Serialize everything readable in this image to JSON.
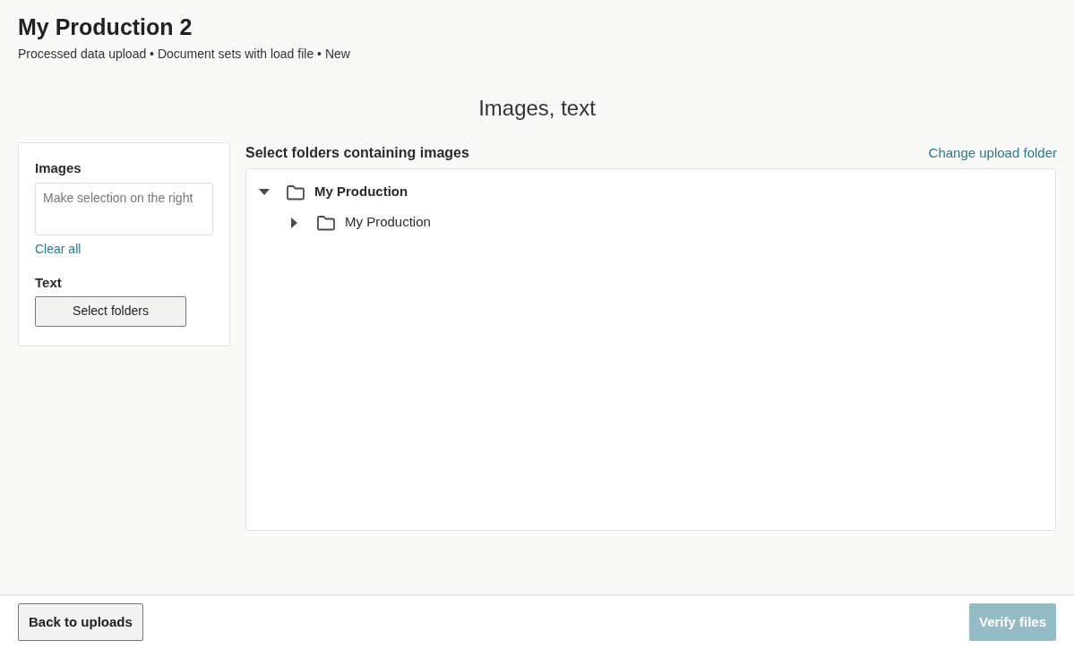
{
  "header": {
    "title": "My Production 2",
    "subtitle": "Processed data upload • Document sets with load file • New"
  },
  "step_title": "Images, text",
  "sidebar": {
    "images_label": "Images",
    "images_field": {
      "placeholder": "Make selection on the right"
    },
    "clear_link": "Clear all",
    "text_label": "Text",
    "select_button": "Select folders"
  },
  "tree_panel": {
    "heading": "Select folders containing images",
    "change_link": "Change upload folder",
    "tree": [
      {
        "label": "My Production",
        "expanded": true,
        "children": [
          {
            "label": "My Production",
            "expanded": false
          }
        ]
      }
    ]
  },
  "footer": {
    "back_button": "Back to uploads",
    "verify_button": {
      "label": "Verify files",
      "disabled": true
    }
  }
}
